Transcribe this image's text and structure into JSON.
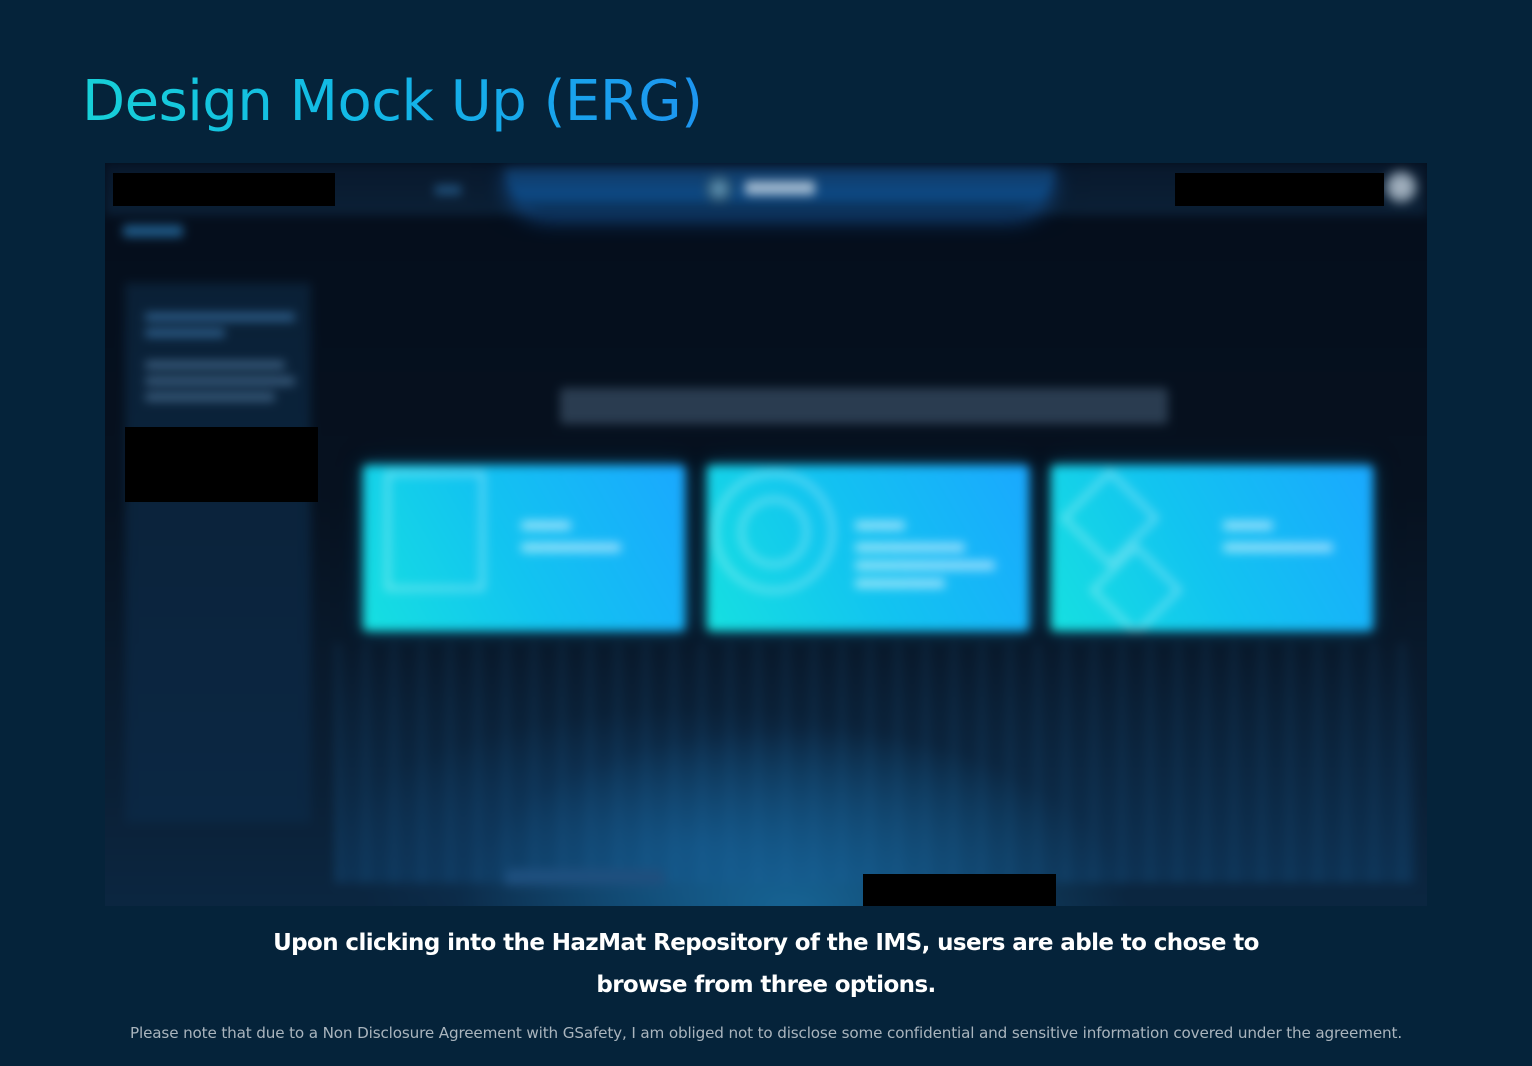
{
  "page": {
    "title": "Design Mock Up (ERG)",
    "caption": "Upon clicking into the HazMat Repository of the IMS, users are able to chose to browse from three options.",
    "disclaimer": "Please note that due to a Non Disclosure Agreement with GSafety, I am obliged not to disclose some confidential and sensitive information covered under the agreement."
  },
  "mockup": {
    "blurred": true,
    "cards": [
      {
        "icon": "document-icon"
      },
      {
        "icon": "target-icon"
      },
      {
        "icon": "diamond-placard-icon"
      }
    ],
    "redactions": 4
  },
  "colors": {
    "background": "#05233a",
    "title_gradient_start": "#17d0d8",
    "title_gradient_end": "#1d95f0",
    "card_gradient_start": "#16e0e0",
    "card_gradient_end": "#1aa8ff",
    "caption_text": "#ffffff",
    "disclaimer_text": "#a9b4bd"
  }
}
